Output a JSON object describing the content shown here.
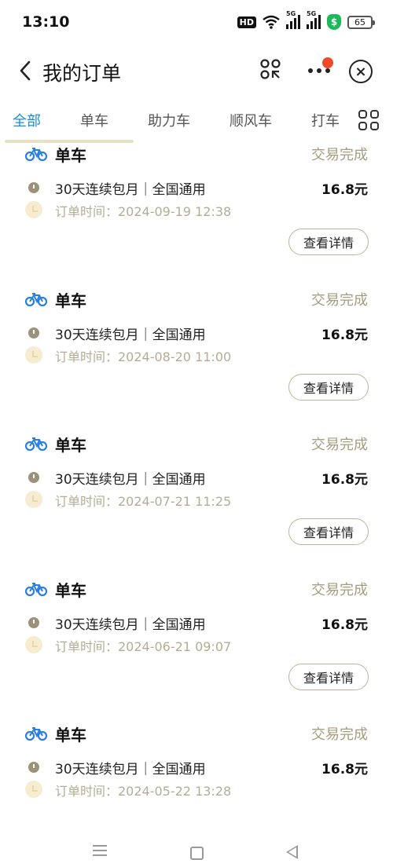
{
  "status_bar": {
    "time": "13:10",
    "hd_label": "HD",
    "network_1": "5G",
    "network_2": "5G",
    "battery": "65"
  },
  "nav": {
    "title": "我的订单"
  },
  "tabs": [
    {
      "label": "全部",
      "active": true
    },
    {
      "label": "单车",
      "active": false
    },
    {
      "label": "助力车",
      "active": false
    },
    {
      "label": "顺风车",
      "active": false
    },
    {
      "label": "打车",
      "active": false
    }
  ],
  "orders": [
    {
      "title": "单车",
      "status": "交易完成",
      "plan": "30天连续包月｜全国通用",
      "price": "16.8元",
      "time": "订单时间：2024-09-19 12:38",
      "button": "查看详情"
    },
    {
      "title": "单车",
      "status": "交易完成",
      "plan": "30天连续包月｜全国通用",
      "price": "16.8元",
      "time": "订单时间：2024-08-20 11:00",
      "button": "查看详情"
    },
    {
      "title": "单车",
      "status": "交易完成",
      "plan": "30天连续包月｜全国通用",
      "price": "16.8元",
      "time": "订单时间：2024-07-21 11:25",
      "button": "查看详情"
    },
    {
      "title": "单车",
      "status": "交易完成",
      "plan": "30天连续包月｜全国通用",
      "price": "16.8元",
      "time": "订单时间：2024-06-21 09:07",
      "button": "查看详情"
    },
    {
      "title": "单车",
      "status": "交易完成",
      "plan": "30天连续包月｜全国通用",
      "price": "16.8元",
      "time": "订单时间：2024-05-22 13:28"
    }
  ],
  "colors": {
    "accent": "#1a8ce0",
    "status_text": "#a69c7f",
    "notification": "#f04a2a",
    "bike_icon": "#2a7fe0"
  },
  "icons": [
    "back-arrow-icon",
    "scan-icon",
    "more-icon",
    "close-icon",
    "grid-icon",
    "bike-icon",
    "info-dot-icon",
    "clock-icon"
  ]
}
